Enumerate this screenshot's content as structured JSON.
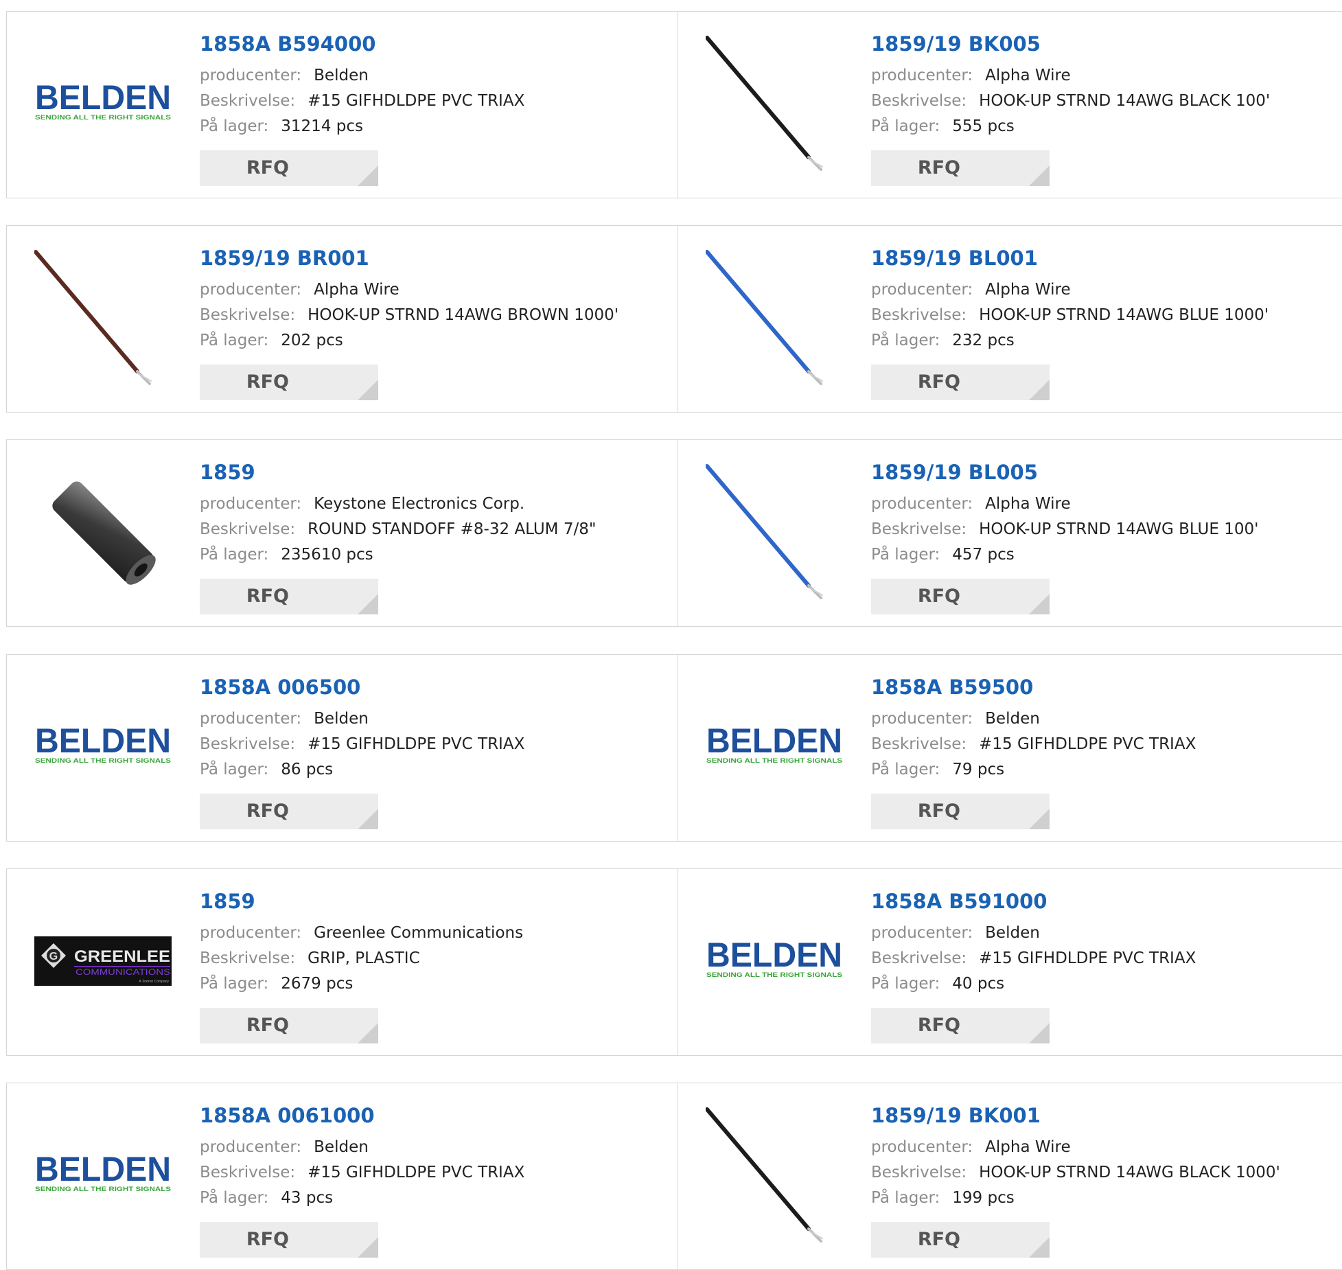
{
  "labels": {
    "manufacturer": "producenter:",
    "description": "Beskrivelse:",
    "stock": "På lager:",
    "rfq": "RFQ"
  },
  "logos": {
    "belden_name": "BELDEN",
    "belden_tagline": "SENDING ALL THE RIGHT SIGNALS",
    "greenlee_name": "GREENLEE",
    "greenlee_sub": "COMMUNICATIONS",
    "greenlee_tiny": "A Textron Company"
  },
  "colors": {
    "link": "#1a62b4",
    "belden_blue": "#1d4f9c",
    "belden_green": "#3aa63a",
    "wire_black": "#1c1c1c",
    "wire_brown": "#5b2a20",
    "wire_blue": "#2f66c9"
  },
  "products": [
    {
      "part_number": "1858A B594000",
      "manufacturer": "Belden",
      "description": "#15 GIFHDLDPE PVC TRIAX",
      "stock": "31214 pcs",
      "image": "belden-logo"
    },
    {
      "part_number": "1859/19 BK005",
      "manufacturer": "Alpha Wire",
      "description": "HOOK-UP STRND 14AWG BLACK 100'",
      "stock": "555 pcs",
      "image": "wire-black"
    },
    {
      "part_number": "1859/19 BR001",
      "manufacturer": "Alpha Wire",
      "description": "HOOK-UP STRND 14AWG BROWN 1000'",
      "stock": "202 pcs",
      "image": "wire-brown"
    },
    {
      "part_number": "1859/19 BL001",
      "manufacturer": "Alpha Wire",
      "description": "HOOK-UP STRND 14AWG BLUE 1000'",
      "stock": "232 pcs",
      "image": "wire-blue"
    },
    {
      "part_number": "1859",
      "manufacturer": "Keystone Electronics Corp.",
      "description": "ROUND STANDOFF #8-32 ALUM 7/8\"",
      "stock": "235610 pcs",
      "image": "standoff"
    },
    {
      "part_number": "1859/19 BL005",
      "manufacturer": "Alpha Wire",
      "description": "HOOK-UP STRND 14AWG BLUE 100'",
      "stock": "457 pcs",
      "image": "wire-blue"
    },
    {
      "part_number": "1858A 006500",
      "manufacturer": "Belden",
      "description": "#15 GIFHDLDPE PVC TRIAX",
      "stock": "86 pcs",
      "image": "belden-logo"
    },
    {
      "part_number": "1858A B59500",
      "manufacturer": "Belden",
      "description": "#15 GIFHDLDPE PVC TRIAX",
      "stock": "79 pcs",
      "image": "belden-logo"
    },
    {
      "part_number": "1859",
      "manufacturer": "Greenlee Communications",
      "description": "GRIP, PLASTIC",
      "stock": "2679 pcs",
      "image": "greenlee-logo"
    },
    {
      "part_number": "1858A B591000",
      "manufacturer": "Belden",
      "description": "#15 GIFHDLDPE PVC TRIAX",
      "stock": "40 pcs",
      "image": "belden-logo"
    },
    {
      "part_number": "1858A 0061000",
      "manufacturer": "Belden",
      "description": "#15 GIFHDLDPE PVC TRIAX",
      "stock": "43 pcs",
      "image": "belden-logo"
    },
    {
      "part_number": "1859/19 BK001",
      "manufacturer": "Alpha Wire",
      "description": "HOOK-UP STRND 14AWG BLACK 1000'",
      "stock": "199 pcs",
      "image": "wire-black"
    }
  ]
}
